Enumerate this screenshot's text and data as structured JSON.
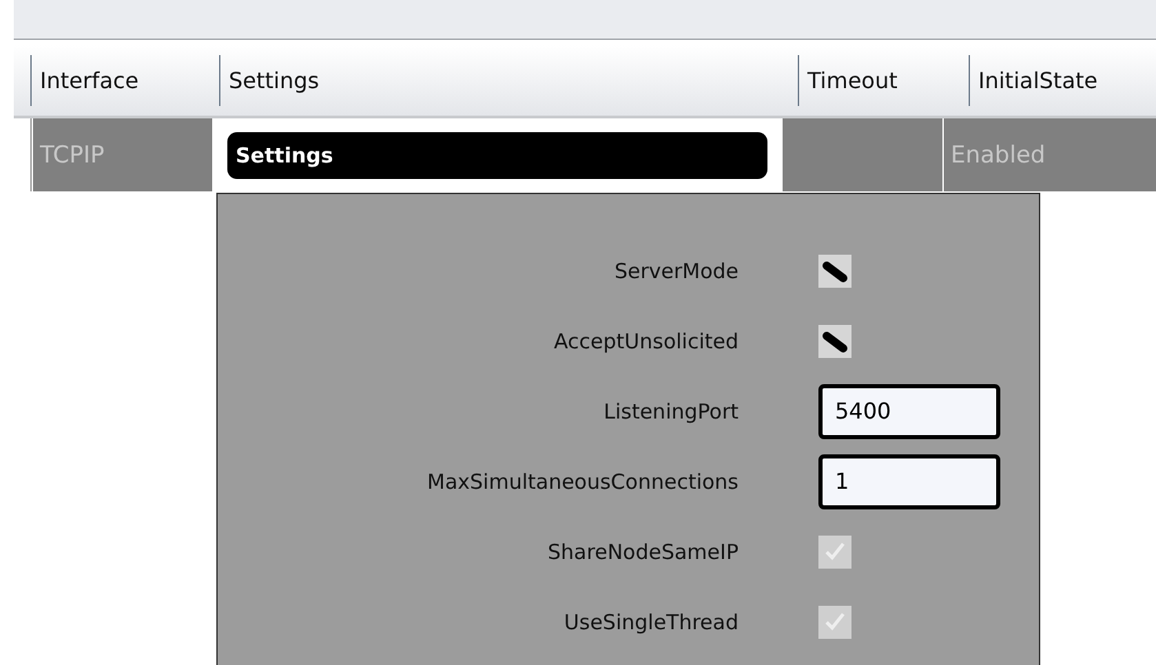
{
  "table": {
    "columns": [
      {
        "label": "Interface"
      },
      {
        "label": "Settings"
      },
      {
        "label": "Timeout"
      },
      {
        "label": "InitialState"
      }
    ],
    "rows": [
      {
        "interface": "TCPIP",
        "settings": "Settings",
        "timeout": "",
        "initial_state": "Enabled",
        "disabled": true
      }
    ]
  },
  "settings_popup": {
    "fields": [
      {
        "kind": "checkbox",
        "label": "ServerMode",
        "checked": true,
        "disabled": false
      },
      {
        "kind": "checkbox",
        "label": "AcceptUnsolicited",
        "checked": true,
        "disabled": false
      },
      {
        "kind": "text",
        "label": "ListeningPort",
        "value": "5400"
      },
      {
        "kind": "text",
        "label": "MaxSimultaneousConnections",
        "value": "1"
      },
      {
        "kind": "checkbox",
        "label": "ShareNodeSameIP",
        "checked": true,
        "disabled": true
      },
      {
        "kind": "checkbox",
        "label": "UseSingleThread",
        "checked": true,
        "disabled": true
      }
    ]
  }
}
